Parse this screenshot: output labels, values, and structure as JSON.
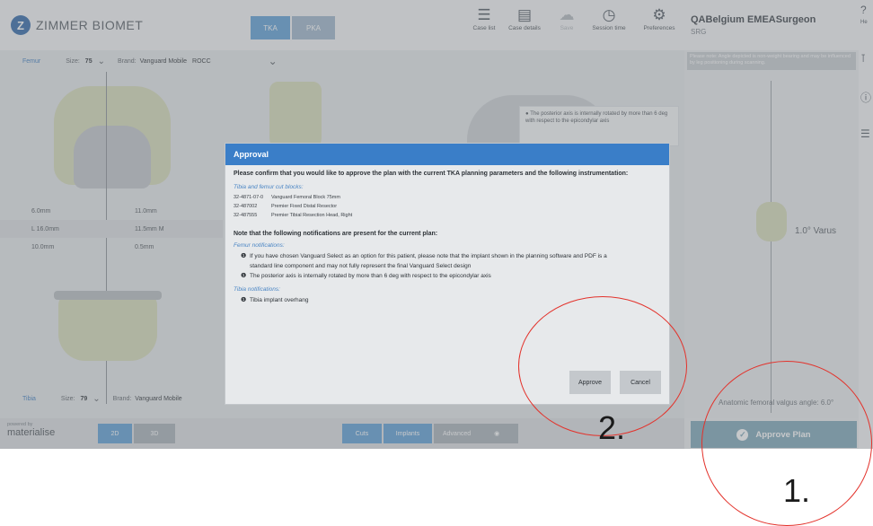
{
  "header": {
    "logo_mark": "Z",
    "logo_text": "ZIMMER BIOMET",
    "segments": [
      {
        "label": "TKA",
        "active": true
      },
      {
        "label": "PKA",
        "active": false
      }
    ],
    "tools": [
      {
        "label": "Case list",
        "icon": "list-icon",
        "glyph": "☰"
      },
      {
        "label": "Case details",
        "icon": "document-icon",
        "glyph": "▤"
      },
      {
        "label": "Save",
        "icon": "cloud-icon",
        "glyph": "☁",
        "disabled": true
      },
      {
        "label": "Session time",
        "icon": "clock-icon",
        "glyph": "◷"
      },
      {
        "label": "Preferences",
        "icon": "gears-icon",
        "glyph": "⚙"
      }
    ],
    "user_name": "QABelgium EMEASurgeon",
    "user_code": "SRG",
    "help_label": "He"
  },
  "femur_bar": {
    "label": "Femur",
    "size_label": "Size:",
    "size_value": "75",
    "brand_label": "Brand:",
    "brand_value": "Vanguard Mobile",
    "brand_extra": "ROCC"
  },
  "measurements": [
    {
      "left": "6.0mm",
      "right": "11.0mm"
    },
    {
      "left": "L 16.0mm",
      "right": "11.5mm M"
    },
    {
      "left": "10.0mm",
      "right": "0.5mm"
    }
  ],
  "notice_text": "The posterior axis is internally rotated by more than 6 deg with respect to the epicondylar axis",
  "right_note": "Please note: Angle depicted is non-weight bearing and may be influenced by leg positioning during scanning.",
  "varus_label": "1.0° Varus",
  "valgus_label": "Anatomic femoral valgus angle: 6.0°",
  "tibia_bar": {
    "label": "Tibia",
    "size_label": "Size:",
    "size_value": "79",
    "brand_label": "Brand:",
    "brand_value": "Vanguard Mobile"
  },
  "bottom": {
    "powered_by": "powered by",
    "brand": "materialise",
    "view_2d": "2D",
    "view_3d": "3D",
    "tabs": [
      "Cuts",
      "Implants",
      "Advanced"
    ],
    "approve_plan": "Approve Plan"
  },
  "modal": {
    "title": "Approval",
    "question": "Please confirm that you would like to approve the plan with the current TKA planning parameters and the following instrumentation:",
    "cut_blocks_heading": "Tibia and femur cut blocks:",
    "instruments": [
      {
        "code": "32-4871-07-0",
        "name": "Vanguard Femoral Block 75mm"
      },
      {
        "code": "32-487002",
        "name": "Premier Fixed Distal Resector"
      },
      {
        "code": "32-487555",
        "name": "Premier Tibial Resection Head, Right"
      }
    ],
    "notifications_intro": "Note that the following notifications are present for the current plan:",
    "femur_heading": "Femur notifications:",
    "femur_notes": [
      "If you have chosen Vanguard Select as an option for this patient, please note that the implant shown in the planning software and PDF is a standard line component and may not fully represent the final Vanguard Select design",
      "The posterior axis is internally rotated by more than 6 deg with respect to the epicondylar axis"
    ],
    "tibia_heading": "Tibia notifications:",
    "tibia_notes": [
      "Tibia implant overhang"
    ],
    "approve_label": "Approve",
    "cancel_label": "Cancel"
  },
  "annotations": {
    "step_1": "1.",
    "step_2": "2."
  },
  "colors": {
    "accent": "#3a7ec8",
    "annotation": "#e3322b",
    "approve_plan": "#7fa7b8"
  }
}
